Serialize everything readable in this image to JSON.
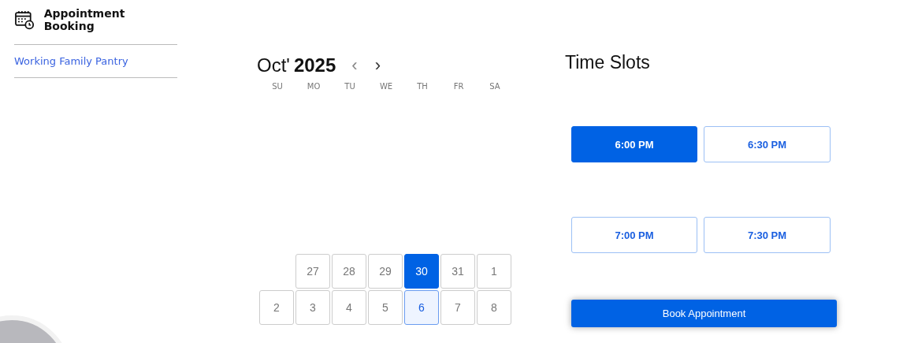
{
  "sidebar": {
    "title": "Appointment Booking",
    "items": [
      {
        "label": "Working Family Pantry",
        "selected": true
      }
    ]
  },
  "calendar": {
    "month": "Oct'",
    "year": "2025",
    "prev": "‹",
    "next": "›",
    "weekdays": [
      "SU",
      "MO",
      "TU",
      "WE",
      "TH",
      "FR",
      "SA"
    ],
    "weeks": [
      [
        {
          "day": "27",
          "selected": false,
          "highlighted": false
        },
        {
          "day": "28",
          "selected": false,
          "highlighted": false
        },
        {
          "day": "29",
          "selected": false,
          "highlighted": false
        },
        {
          "day": "30",
          "selected": true,
          "highlighted": false
        },
        {
          "day": "31",
          "selected": false,
          "highlighted": false
        },
        {
          "day": "1",
          "selected": false,
          "highlighted": false
        }
      ],
      [
        {
          "day": "2",
          "selected": false,
          "highlighted": false
        },
        {
          "day": "3",
          "selected": false,
          "highlighted": false
        },
        {
          "day": "4",
          "selected": false,
          "highlighted": false
        },
        {
          "day": "5",
          "selected": false,
          "highlighted": false
        },
        {
          "day": "6",
          "selected": false,
          "highlighted": true
        },
        {
          "day": "7",
          "selected": false,
          "highlighted": false
        },
        {
          "day": "8",
          "selected": false,
          "highlighted": false
        }
      ]
    ]
  },
  "time_slots": {
    "title": "Time Slots",
    "slots": [
      {
        "label": "6:00 PM",
        "selected": true
      },
      {
        "label": "6:30 PM",
        "selected": false
      },
      {
        "label": "7:00 PM",
        "selected": false
      },
      {
        "label": "7:30 PM",
        "selected": false
      }
    ],
    "button": "Book Appointment"
  }
}
